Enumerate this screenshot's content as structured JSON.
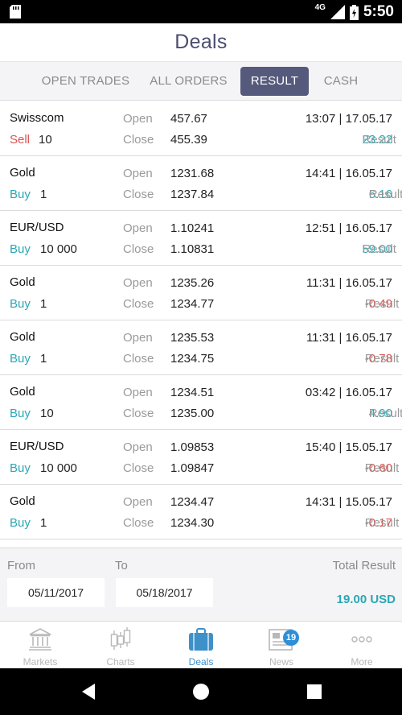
{
  "status_bar": {
    "network": "4G",
    "time": "5:50"
  },
  "header": {
    "title": "Deals"
  },
  "tabs": [
    {
      "label": "OPEN TRADES",
      "active": false
    },
    {
      "label": "ALL ORDERS",
      "active": false
    },
    {
      "label": "RESULT",
      "active": true
    },
    {
      "label": "CASH",
      "active": false
    }
  ],
  "labels": {
    "open": "Open",
    "close": "Close",
    "result": "Result"
  },
  "deals": [
    {
      "instrument": "Swisscom",
      "side": "Sell",
      "qty": "10",
      "open": "457.67",
      "close": "455.39",
      "datetime": "13:07 | 17.05.17",
      "result": "23.22"
    },
    {
      "instrument": "Gold",
      "side": "Buy",
      "qty": "1",
      "open": "1231.68",
      "close": "1237.84",
      "datetime": "14:41 | 16.05.17",
      "result": "6.16"
    },
    {
      "instrument": "EUR/USD",
      "side": "Buy",
      "qty": "10 000",
      "open": "1.10241",
      "close": "1.10831",
      "datetime": "12:51 | 16.05.17",
      "result": "59.00"
    },
    {
      "instrument": "Gold",
      "side": "Buy",
      "qty": "1",
      "open": "1235.26",
      "close": "1234.77",
      "datetime": "11:31 | 16.05.17",
      "result": "-0.49"
    },
    {
      "instrument": "Gold",
      "side": "Buy",
      "qty": "1",
      "open": "1235.53",
      "close": "1234.75",
      "datetime": "11:31 | 16.05.17",
      "result": "-0.78"
    },
    {
      "instrument": "Gold",
      "side": "Buy",
      "qty": "10",
      "open": "1234.51",
      "close": "1235.00",
      "datetime": "03:42 | 16.05.17",
      "result": "4.90"
    },
    {
      "instrument": "EUR/USD",
      "side": "Buy",
      "qty": "10 000",
      "open": "1.09853",
      "close": "1.09847",
      "datetime": "15:40 | 15.05.17",
      "result": "-0.60"
    },
    {
      "instrument": "Gold",
      "side": "Buy",
      "qty": "1",
      "open": "1234.47",
      "close": "1234.30",
      "datetime": "14:31 | 15.05.17",
      "result": "-0.17"
    }
  ],
  "filter": {
    "from_label": "From",
    "to_label": "To",
    "from_date": "05/11/2017",
    "to_date": "05/18/2017",
    "total_label": "Total Result",
    "total_value": "19.00 USD"
  },
  "bottom_nav": [
    {
      "label": "Markets",
      "icon": "bank-icon",
      "active": false
    },
    {
      "label": "Charts",
      "icon": "candlestick-icon",
      "active": false
    },
    {
      "label": "Deals",
      "icon": "briefcase-icon",
      "active": true
    },
    {
      "label": "News",
      "icon": "newspaper-icon",
      "active": false,
      "badge": "19"
    },
    {
      "label": "More",
      "icon": "more-dots-icon",
      "active": false
    }
  ],
  "colors": {
    "accent": "#555a7c",
    "title": "#4a4e70",
    "positive": "#2aa7b5",
    "negative": "#d9534f",
    "nav_active": "#3e90c9"
  }
}
